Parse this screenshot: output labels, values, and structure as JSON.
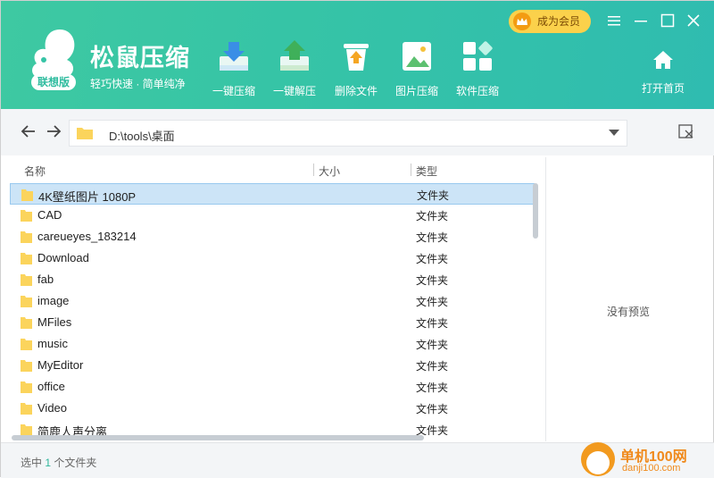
{
  "app": {
    "title": "松鼠压缩",
    "slogan": "轻巧快速 · 简单纯净",
    "badge": "联想版",
    "accent": "#36c4a6"
  },
  "toolbar": {
    "items": [
      {
        "label": "一键压缩",
        "icon": "compress-icon"
      },
      {
        "label": "一键解压",
        "icon": "extract-icon"
      },
      {
        "label": "删除文件",
        "icon": "delete-file-icon"
      },
      {
        "label": "图片压缩",
        "icon": "image-compress-icon"
      },
      {
        "label": "软件压缩",
        "icon": "software-compress-icon"
      }
    ],
    "member_label": "成为会员",
    "home_label": "打开首页"
  },
  "address": {
    "path": "D:\\tools\\桌面"
  },
  "list": {
    "headers": {
      "name": "名称",
      "size": "大小",
      "type": "类型"
    },
    "rows": [
      {
        "name": "4K壁纸图片 1080P",
        "type": "文件夹"
      },
      {
        "name": "CAD",
        "type": "文件夹"
      },
      {
        "name": "careueyes_183214",
        "type": "文件夹"
      },
      {
        "name": "Download",
        "type": "文件夹"
      },
      {
        "name": "fab",
        "type": "文件夹"
      },
      {
        "name": "image",
        "type": "文件夹"
      },
      {
        "name": "MFiles",
        "type": "文件夹"
      },
      {
        "name": "music",
        "type": "文件夹"
      },
      {
        "name": "MyEditor",
        "type": "文件夹"
      },
      {
        "name": "office",
        "type": "文件夹"
      },
      {
        "name": "Video",
        "type": "文件夹"
      },
      {
        "name": "简鹿人声分离",
        "type": "文件夹"
      }
    ]
  },
  "preview": {
    "empty_text": "没有预览"
  },
  "status": {
    "prefix": "选中",
    "count": "1",
    "suffix": "个文件夹"
  },
  "watermark": {
    "title": "单机100网",
    "url": "danji100.com"
  }
}
